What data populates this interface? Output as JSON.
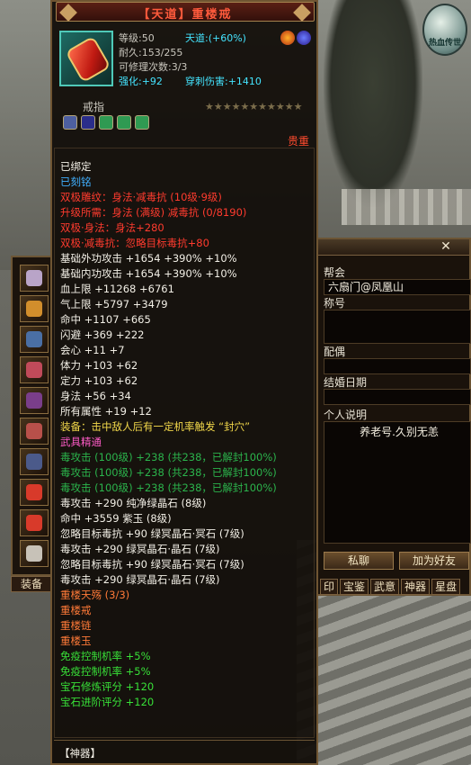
{
  "item": {
    "title": "【天道】重楼戒",
    "level": "等级:50",
    "tiandao": "天道:",
    "tiandao_val": "(+60%)",
    "durability": "耐久:153/255",
    "repair": "可修理次数:3/3",
    "enhance_label": "强化:",
    "enhance_val": "+92",
    "pierce_label": "穿刺伤害:",
    "pierce_val": "+1410",
    "type": "戒指",
    "price": "贵重",
    "stars": "★★★★★★★★★★★"
  },
  "lines": [
    {
      "t": "已绑定",
      "c": "w"
    },
    {
      "t": "已刻铭",
      "c": "b"
    },
    {
      "t": "双极雕纹：身法·减毒抗 (10级·9级)",
      "c": "r"
    },
    {
      "t": "升级所需：身法 (满级)   减毒抗 (0/8190)",
      "c": "r"
    },
    {
      "t": "双极·身法：身法+280",
      "c": "r"
    },
    {
      "t": "双极·减毒抗：忽略目标毒抗+80",
      "c": "r"
    },
    {
      "t": "基础外功攻击 +1654 +390% +10%",
      "c": "w"
    },
    {
      "t": "基础内功攻击 +1654 +390% +10%",
      "c": "w"
    },
    {
      "t": "血上限 +11268 +6761",
      "c": "w"
    },
    {
      "t": "气上限 +5797 +3479",
      "c": "w"
    },
    {
      "t": "命中 +1107 +665",
      "c": "w"
    },
    {
      "t": "闪避 +369 +222",
      "c": "w"
    },
    {
      "t": "会心 +11 +7",
      "c": "w"
    },
    {
      "t": "体力 +103 +62",
      "c": "w"
    },
    {
      "t": "定力 +103 +62",
      "c": "w"
    },
    {
      "t": "身法 +56 +34",
      "c": "w"
    },
    {
      "t": "所有属性 +19 +12",
      "c": "w"
    },
    {
      "t": "装备：击中敌人后有一定机率触发 “封穴”",
      "c": "y"
    },
    {
      "t": "武具精通",
      "c": "pk"
    },
    {
      "t": "毒攻击 (100级) +238 (共238，已解封100%)",
      "c": "dg"
    },
    {
      "t": "毒攻击 (100级) +238 (共238，已解封100%)",
      "c": "dg"
    },
    {
      "t": "毒攻击 (100级) +238 (共238，已解封100%)",
      "c": "dg"
    },
    {
      "t": "毒攻击 +290 纯净绿晶石 (8级)",
      "c": "w"
    },
    {
      "t": "命中 +3559 紫玉 (8级)",
      "c": "w"
    },
    {
      "t": "忽略目标毒抗 +90 绿冥晶石·冥石 (7级)",
      "c": "w"
    },
    {
      "t": "毒攻击 +290 绿冥晶石·晶石 (7级)",
      "c": "w"
    },
    {
      "t": "忽略目标毒抗 +90 绿冥晶石·冥石 (7级)",
      "c": "w"
    },
    {
      "t": "毒攻击 +290 绿冥晶石·晶石 (7级)",
      "c": "w"
    },
    {
      "t": "重楼天殇 (3/3)",
      "c": "o"
    },
    {
      "t": "重楼戒",
      "c": "o"
    },
    {
      "t": "重楼链",
      "c": "o"
    },
    {
      "t": "重楼玉",
      "c": "o"
    },
    {
      "t": "免疫控制机率 +5%",
      "c": "g"
    },
    {
      "t": "免疫控制机率 +5%",
      "c": "g"
    },
    {
      "t": "宝石修炼评分 +120",
      "c": "g"
    },
    {
      "t": "宝石进阶评分 +120",
      "c": "g"
    }
  ],
  "footer": {
    "section": "【神器】"
  },
  "panel": {
    "guild_label": "帮会",
    "guild_value": "六扇门@凤凰山",
    "title_label": "称号",
    "spouse_label": "配偶",
    "wedding_label": "结婚日期",
    "bio_label": "个人说明",
    "bio_value": "养老号.久别无恙",
    "msg_btn": "私聊",
    "add_friend_btn": "加为好友",
    "tabs": [
      "印",
      "宝鉴",
      "武意",
      "神器",
      "星盘"
    ]
  },
  "strip": {
    "equip_tab": "装备"
  },
  "logo": {
    "text": "热血传世"
  },
  "colors": {
    "title_red": "#ff5a3c",
    "cyan": "#44e4ff",
    "blue": "#40b0ff",
    "red": "#ff3b2e",
    "orange": "#ff7a38",
    "green": "#38e038",
    "dark_green": "#2bb44c",
    "yellow": "#f0d64a",
    "pink": "#ff5cc8"
  }
}
